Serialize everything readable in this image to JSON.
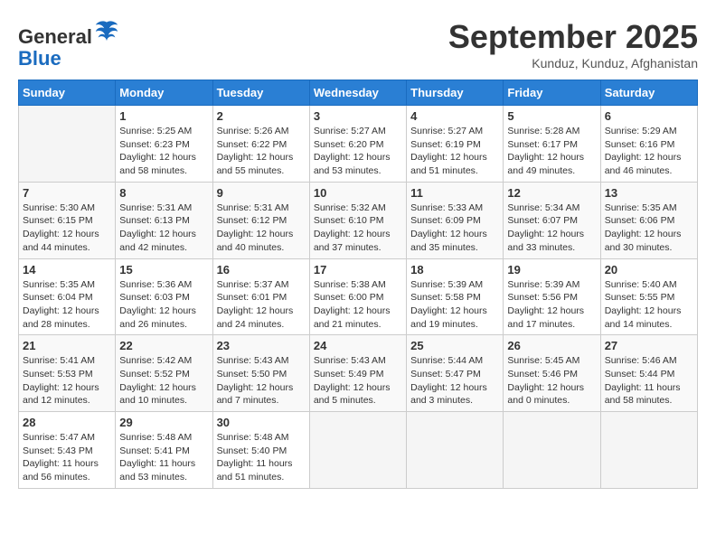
{
  "header": {
    "logo_line1": "General",
    "logo_line2": "Blue",
    "month_title": "September 2025",
    "subtitle": "Kunduz, Kunduz, Afghanistan"
  },
  "days_of_week": [
    "Sunday",
    "Monday",
    "Tuesday",
    "Wednesday",
    "Thursday",
    "Friday",
    "Saturday"
  ],
  "weeks": [
    [
      {
        "day": "",
        "content": ""
      },
      {
        "day": "1",
        "content": "Sunrise: 5:25 AM\nSunset: 6:23 PM\nDaylight: 12 hours\nand 58 minutes."
      },
      {
        "day": "2",
        "content": "Sunrise: 5:26 AM\nSunset: 6:22 PM\nDaylight: 12 hours\nand 55 minutes."
      },
      {
        "day": "3",
        "content": "Sunrise: 5:27 AM\nSunset: 6:20 PM\nDaylight: 12 hours\nand 53 minutes."
      },
      {
        "day": "4",
        "content": "Sunrise: 5:27 AM\nSunset: 6:19 PM\nDaylight: 12 hours\nand 51 minutes."
      },
      {
        "day": "5",
        "content": "Sunrise: 5:28 AM\nSunset: 6:17 PM\nDaylight: 12 hours\nand 49 minutes."
      },
      {
        "day": "6",
        "content": "Sunrise: 5:29 AM\nSunset: 6:16 PM\nDaylight: 12 hours\nand 46 minutes."
      }
    ],
    [
      {
        "day": "7",
        "content": "Sunrise: 5:30 AM\nSunset: 6:15 PM\nDaylight: 12 hours\nand 44 minutes."
      },
      {
        "day": "8",
        "content": "Sunrise: 5:31 AM\nSunset: 6:13 PM\nDaylight: 12 hours\nand 42 minutes."
      },
      {
        "day": "9",
        "content": "Sunrise: 5:31 AM\nSunset: 6:12 PM\nDaylight: 12 hours\nand 40 minutes."
      },
      {
        "day": "10",
        "content": "Sunrise: 5:32 AM\nSunset: 6:10 PM\nDaylight: 12 hours\nand 37 minutes."
      },
      {
        "day": "11",
        "content": "Sunrise: 5:33 AM\nSunset: 6:09 PM\nDaylight: 12 hours\nand 35 minutes."
      },
      {
        "day": "12",
        "content": "Sunrise: 5:34 AM\nSunset: 6:07 PM\nDaylight: 12 hours\nand 33 minutes."
      },
      {
        "day": "13",
        "content": "Sunrise: 5:35 AM\nSunset: 6:06 PM\nDaylight: 12 hours\nand 30 minutes."
      }
    ],
    [
      {
        "day": "14",
        "content": "Sunrise: 5:35 AM\nSunset: 6:04 PM\nDaylight: 12 hours\nand 28 minutes."
      },
      {
        "day": "15",
        "content": "Sunrise: 5:36 AM\nSunset: 6:03 PM\nDaylight: 12 hours\nand 26 minutes."
      },
      {
        "day": "16",
        "content": "Sunrise: 5:37 AM\nSunset: 6:01 PM\nDaylight: 12 hours\nand 24 minutes."
      },
      {
        "day": "17",
        "content": "Sunrise: 5:38 AM\nSunset: 6:00 PM\nDaylight: 12 hours\nand 21 minutes."
      },
      {
        "day": "18",
        "content": "Sunrise: 5:39 AM\nSunset: 5:58 PM\nDaylight: 12 hours\nand 19 minutes."
      },
      {
        "day": "19",
        "content": "Sunrise: 5:39 AM\nSunset: 5:56 PM\nDaylight: 12 hours\nand 17 minutes."
      },
      {
        "day": "20",
        "content": "Sunrise: 5:40 AM\nSunset: 5:55 PM\nDaylight: 12 hours\nand 14 minutes."
      }
    ],
    [
      {
        "day": "21",
        "content": "Sunrise: 5:41 AM\nSunset: 5:53 PM\nDaylight: 12 hours\nand 12 minutes."
      },
      {
        "day": "22",
        "content": "Sunrise: 5:42 AM\nSunset: 5:52 PM\nDaylight: 12 hours\nand 10 minutes."
      },
      {
        "day": "23",
        "content": "Sunrise: 5:43 AM\nSunset: 5:50 PM\nDaylight: 12 hours\nand 7 minutes."
      },
      {
        "day": "24",
        "content": "Sunrise: 5:43 AM\nSunset: 5:49 PM\nDaylight: 12 hours\nand 5 minutes."
      },
      {
        "day": "25",
        "content": "Sunrise: 5:44 AM\nSunset: 5:47 PM\nDaylight: 12 hours\nand 3 minutes."
      },
      {
        "day": "26",
        "content": "Sunrise: 5:45 AM\nSunset: 5:46 PM\nDaylight: 12 hours\nand 0 minutes."
      },
      {
        "day": "27",
        "content": "Sunrise: 5:46 AM\nSunset: 5:44 PM\nDaylight: 11 hours\nand 58 minutes."
      }
    ],
    [
      {
        "day": "28",
        "content": "Sunrise: 5:47 AM\nSunset: 5:43 PM\nDaylight: 11 hours\nand 56 minutes."
      },
      {
        "day": "29",
        "content": "Sunrise: 5:48 AM\nSunset: 5:41 PM\nDaylight: 11 hours\nand 53 minutes."
      },
      {
        "day": "30",
        "content": "Sunrise: 5:48 AM\nSunset: 5:40 PM\nDaylight: 11 hours\nand 51 minutes."
      },
      {
        "day": "",
        "content": ""
      },
      {
        "day": "",
        "content": ""
      },
      {
        "day": "",
        "content": ""
      },
      {
        "day": "",
        "content": ""
      }
    ]
  ]
}
